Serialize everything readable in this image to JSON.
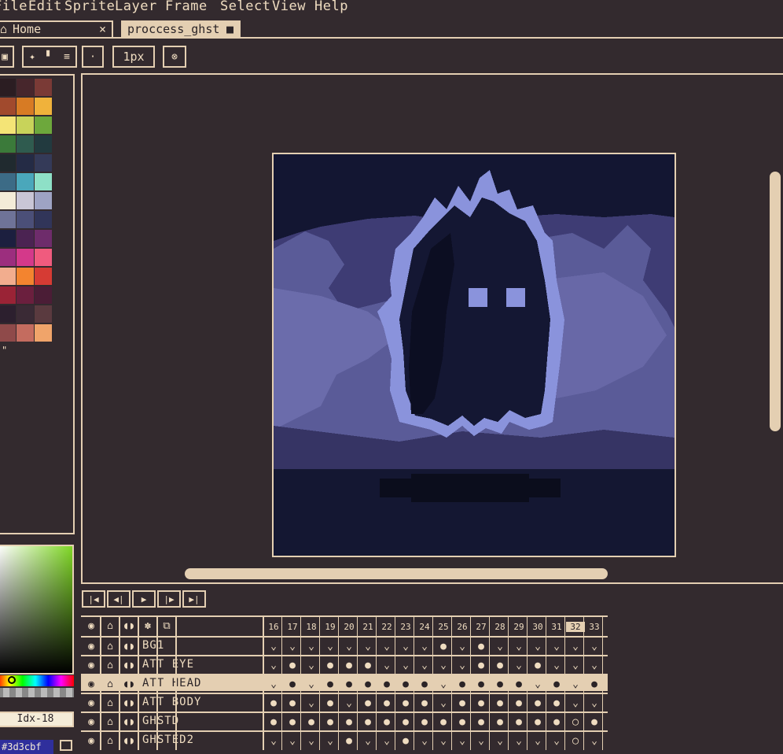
{
  "menu": [
    "File",
    "Edit",
    "Sprite",
    "Layer",
    "Frame",
    "Select",
    "View",
    "Help"
  ],
  "tabs": {
    "home": {
      "label": "Home",
      "close": "×"
    },
    "file": {
      "label": "proccess_ghst",
      "modified": "■"
    }
  },
  "toolbar": {
    "brush_size": "1px"
  },
  "palette": [
    "#2b1d22",
    "#47262c",
    "#7a3a36",
    "#a14a2d",
    "#d77b24",
    "#f0b23b",
    "#f4e476",
    "#c8d35a",
    "#6da83c",
    "#3b7a3a",
    "#2f5b4f",
    "#223a3f",
    "#202a2f",
    "#242b45",
    "#343a58",
    "#3c6b86",
    "#4aa7bb",
    "#8ee0c7",
    "#f4ecd8",
    "#c9c6d6",
    "#9ea3c4",
    "#6f7398",
    "#4b4f78",
    "#313559",
    "#1c1f3f",
    "#4b2352",
    "#6e2c6b",
    "#9c2e7e",
    "#d4398a",
    "#f05b7e",
    "#f2ad8e",
    "#f3842f",
    "#d63b34",
    "#9a2336",
    "#6b1f3e",
    "#4b1d36",
    "#2c1f2e",
    "#3a2a35",
    "#5a3a3f",
    "#8f4a4a",
    "#c46c5f",
    "#f0a46a"
  ],
  "picker": {
    "index_label": "Idx-18",
    "hex": "#3d3cbf"
  },
  "timeline": {
    "frames": [
      "16",
      "17",
      "18",
      "19",
      "20",
      "21",
      "22",
      "23",
      "24",
      "25",
      "26",
      "27",
      "28",
      "29",
      "30",
      "31",
      "32",
      "33"
    ],
    "current_frame": "32",
    "layers": [
      {
        "name": "BG1",
        "cels": "⌄⌄⌄⌄⌄⌄⌄⌄⌄●⌄●⌄⌄⌄⌄"
      },
      {
        "name": "ATT EYE",
        "cels": "⌄●⌄●●●⌄⌄⌄⌄⌄●●⌄●⌄"
      },
      {
        "name": "ATT HEAD",
        "cels": "⌄●⌄●●●●●●⌄●●●●⌄●",
        "selected": true
      },
      {
        "name": "ATT BODY",
        "cels": "●●⌄●⌄●●●●⌄●●●●●●"
      },
      {
        "name": "GHSTD",
        "cels": "●●●●●●●●●●●●●●●●"
      },
      {
        "name": "GHSTED2",
        "cels": "⌄⌄⌄⌄●⌄⌄●⌄⌄⌄⌄⌄⌄⌄⌄"
      }
    ],
    "current_cels": [
      "⌄",
      "⌄",
      "⌄",
      "⌄",
      "◯",
      "◯"
    ],
    "next_cels": [
      "⌄",
      "⌄",
      "●",
      "⌄",
      "●",
      "⌄"
    ]
  }
}
